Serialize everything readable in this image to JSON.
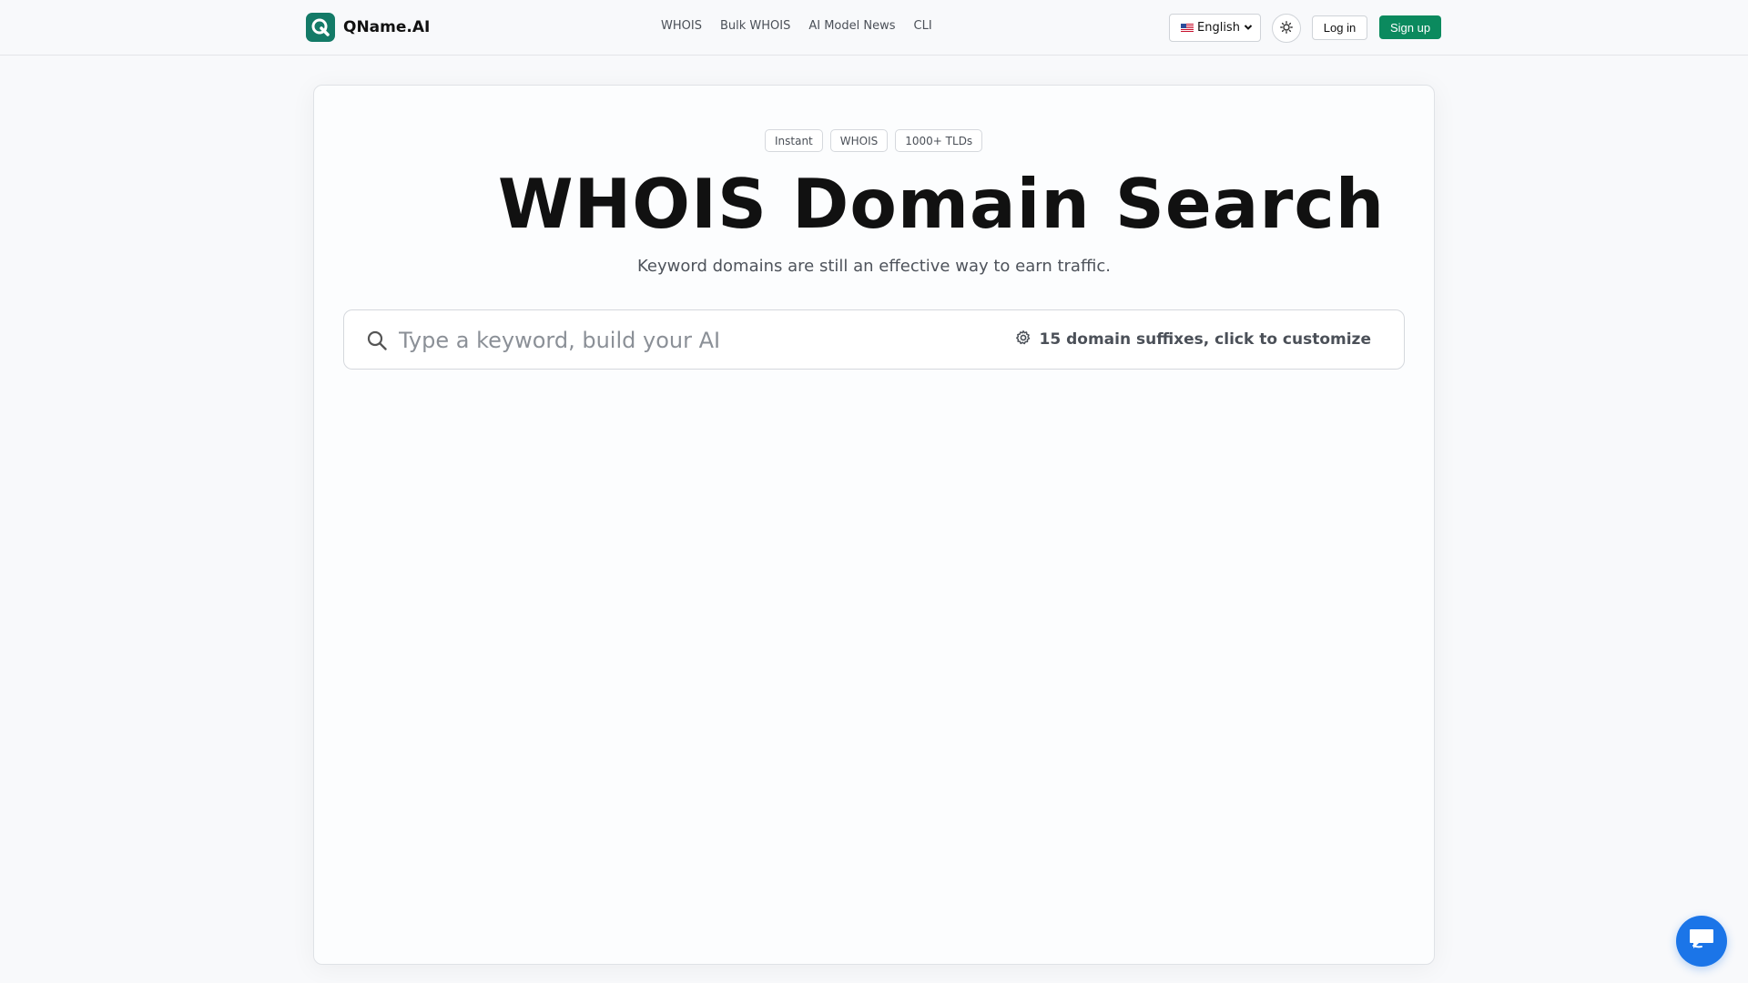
{
  "brand": {
    "name": "QName.AI",
    "icon": "qname-logo-icon"
  },
  "nav": {
    "items": [
      "WHOIS",
      "Bulk WHOIS",
      "AI Model News",
      "CLI"
    ]
  },
  "header": {
    "language": {
      "selected": "English",
      "flag": "us-flag-icon"
    },
    "theme_icon": "sun-icon",
    "login_label": "Log in",
    "signup_label": "Sign up"
  },
  "hero": {
    "tags": [
      "Instant",
      "WHOIS",
      "1000+ TLDs"
    ],
    "title": "WHOIS Domain Search",
    "subtitle": "Keyword domains are still an effective way to earn traffic."
  },
  "search": {
    "value": "",
    "placeholder": "Type a keyword, build your AI",
    "suffix_label": "15 domain suffixes, click to customize",
    "search_icon": "search-icon",
    "settings_icon": "gear-icon"
  },
  "chat": {
    "icon": "chat-bubble-icon"
  },
  "colors": {
    "brand": "#137a67",
    "signup_bg": "#0b8a5e",
    "chat_fab": "#1b75e8",
    "page_bg": "#f8f9fb"
  }
}
